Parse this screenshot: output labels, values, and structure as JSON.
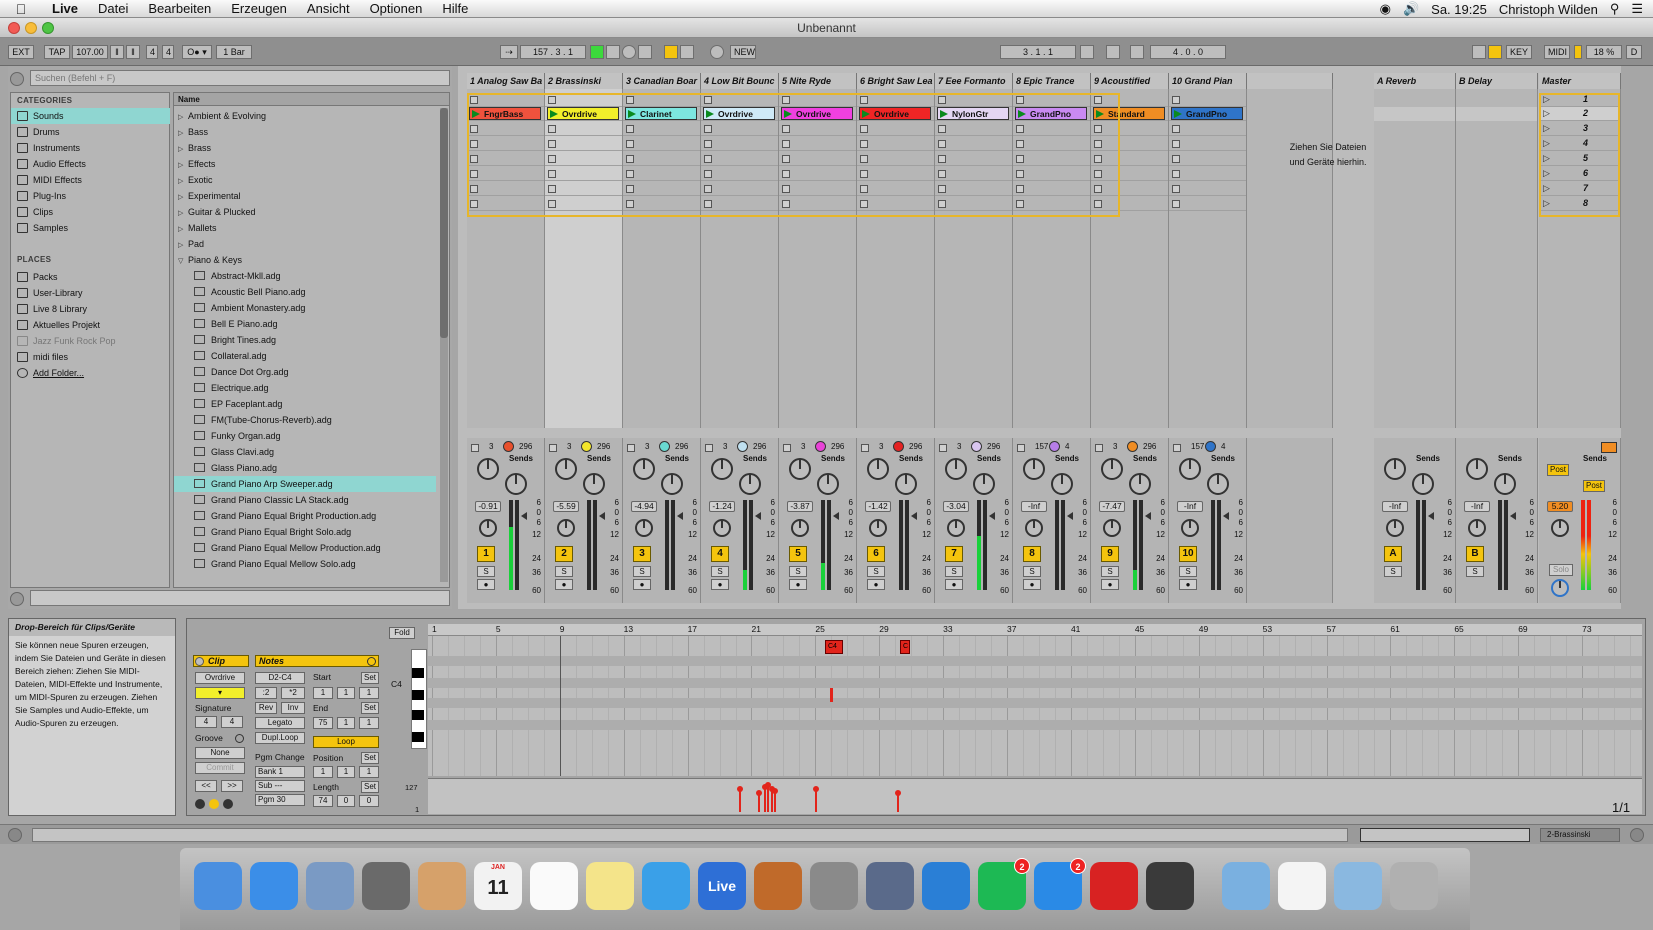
{
  "menubar": {
    "app": "Live",
    "items": [
      "Datei",
      "Bearbeiten",
      "Erzeugen",
      "Ansicht",
      "Optionen",
      "Hilfe"
    ],
    "clock": "Sa. 19:25",
    "user": "Christoph Wilden"
  },
  "window": {
    "title": "Unbenannt"
  },
  "transport": {
    "ext": "EXT",
    "tap": "TAP",
    "tempo": "107.00",
    "signature_num": "4",
    "signature_den": "4",
    "quantize": "1 Bar",
    "arrangement_pos": "157 .  3 .  1",
    "new": "NEW",
    "loop_start": "3 .  1 .  1",
    "loop_length": "4 .  0 .  0",
    "key": "KEY",
    "midi": "MIDI",
    "cpu": "18 %",
    "d": "D"
  },
  "browser": {
    "search_placeholder": "Suchen (Befehl + F)",
    "categories_title": "CATEGORIES",
    "categories": [
      "Sounds",
      "Drums",
      "Instruments",
      "Audio Effects",
      "MIDI Effects",
      "Plug-Ins",
      "Clips",
      "Samples"
    ],
    "places_title": "PLACES",
    "places": [
      "Packs",
      "User-Library",
      "Live 8 Library",
      "Aktuelles Projekt",
      "Jazz Funk Rock Pop",
      "midi files",
      "Add Folder..."
    ],
    "name_header": "Name",
    "folders": [
      "Ambient & Evolving",
      "Bass",
      "Brass",
      "Effects",
      "Exotic",
      "Experimental",
      "Guitar & Plucked",
      "Mallets",
      "Pad",
      "Piano & Keys"
    ],
    "files": [
      "Abstract-Mkll.adg",
      "Acoustic Bell Piano.adg",
      "Ambient Monastery.adg",
      "Bell E Piano.adg",
      "Bright Tines.adg",
      "Collateral.adg",
      "Dance Dot Org.adg",
      "Electrique.adg",
      "EP Faceplant.adg",
      "FM(Tube-Chorus-Reverb).adg",
      "Funky Organ.adg",
      "Glass Clavi.adg",
      "Glass Piano.adg",
      "Grand Piano Arp Sweeper.adg",
      "Grand Piano Classic LA Stack.adg",
      "Grand Piano Equal Bright Production.adg",
      "Grand Piano Equal Bright Solo.adg",
      "Grand Piano Equal Mellow Production.adg",
      "Grand Piano Equal Mellow Solo.adg"
    ]
  },
  "tracks": [
    {
      "name": "1 Analog Saw Ba",
      "clip": "FngrBass",
      "color": "#f0523d",
      "num": "1",
      "vol": "-0.91",
      "in": "3",
      "out": "296",
      "dot": "#e8502c",
      "meter": 0.7
    },
    {
      "name": "2 Brassinski",
      "clip": "Ovrdrive",
      "color": "#f2ef2b",
      "num": "2",
      "vol": "-5.59",
      "in": "3",
      "out": "296",
      "dot": "#f3e52b",
      "meter": 0.0
    },
    {
      "name": "3 Canadian Boar",
      "clip": "Clarinet",
      "color": "#7de6e0",
      "num": "3",
      "vol": "-4.94",
      "in": "3",
      "out": "296",
      "dot": "#69d9d1",
      "meter": 0.0
    },
    {
      "name": "4 Low Bit Bounc",
      "clip": "Ovrdrive",
      "color": "#cfeaf7",
      "num": "4",
      "vol": "-1.24",
      "in": "3",
      "out": "296",
      "dot": "#bfe0f0",
      "meter": 0.22
    },
    {
      "name": "5 Nite Ryde",
      "clip": "Ovrdrive",
      "color": "#f040e0",
      "num": "5",
      "vol": "-3.87",
      "in": "3",
      "out": "296",
      "dot": "#e843d7",
      "meter": 0.3
    },
    {
      "name": "6 Bright Saw Lea",
      "clip": "Ovrdrive",
      "color": "#f02525",
      "num": "6",
      "vol": "-1.42",
      "in": "3",
      "out": "296",
      "dot": "#e42222",
      "meter": 0.0
    },
    {
      "name": "7 Eee Formanto",
      "clip": "NylonGtr",
      "color": "#e4d6f3",
      "num": "7",
      "vol": "-3.04",
      "in": "3",
      "out": "296",
      "dot": "#d9c6f0",
      "meter": 0.6
    },
    {
      "name": "8 Epic Trance",
      "clip": "GrandPno",
      "color": "#c98af2",
      "num": "8",
      "vol": "-Inf",
      "in": "157",
      "out": "4",
      "dot": "#b77ee8",
      "meter": 0.0
    },
    {
      "name": "9 Acoustified",
      "clip": "Standard",
      "color": "#f08d23",
      "num": "9",
      "vol": "-7.47",
      "in": "3",
      "out": "296",
      "dot": "#f08d23",
      "meter": 0.22
    },
    {
      "name": "10 Grand Pian",
      "clip": "GrandPno",
      "color": "#2f74c8",
      "num": "10",
      "vol": "-Inf",
      "in": "157",
      "out": "4",
      "dot": "#2f74c8",
      "meter": 0.0
    }
  ],
  "returns": [
    {
      "name": "A Reverb",
      "letter": "A",
      "vol": "-Inf"
    },
    {
      "name": "B Delay",
      "letter": "B",
      "vol": "-Inf"
    }
  ],
  "master": {
    "name": "Master",
    "vol": "5.20",
    "post1": "Post",
    "post2": "Post",
    "solo": "Solo"
  },
  "scenes": [
    "1",
    "2",
    "3",
    "4",
    "5",
    "6",
    "7",
    "8"
  ],
  "drop_text_1": "Ziehen Sie Dateien",
  "drop_text_2": "und Geräte hierhin.",
  "sends_label": "Sends",
  "scale": [
    "6",
    "0",
    "6",
    "12",
    "24",
    "36",
    "60"
  ],
  "info": {
    "title": "Drop-Bereich für Clips/Geräte",
    "body": "Sie können neue Spuren erzeugen, indem Sie Dateien und Geräte in diesen Bereich ziehen: Ziehen Sie MIDI-Dateien, MIDI-Effekte und Instrumente, um MIDI-Spuren zu erzeugen. Ziehen Sie Samples und Audio-Effekte, um Audio-Spuren zu erzeugen."
  },
  "clipview": {
    "clip_tab": "Clip",
    "notes_tab": "Notes",
    "clip_name": "Ovrdrive",
    "signature": "Signature",
    "sig_num": "4",
    "sig_den": "4",
    "groove": "Groove",
    "groove_val": "None",
    "commit": "Commit",
    "range": "D2-C4",
    "half": ":2",
    "double": "*2",
    "rev": "Rev",
    "inv": "Inv",
    "legato": "Legato",
    "dupl_loop": "Dupl.Loop",
    "start": "Start",
    "end": "End",
    "set": "Set",
    "loop": "Loop",
    "position": "Position",
    "length": "Length",
    "pgm_change": "Pgm Change",
    "bank": "Bank 1",
    "sub": "Sub ---",
    "pgm": "Pgm 30",
    "start_val": [
      "1",
      "1",
      "1"
    ],
    "end_val": [
      "75",
      "1",
      "1"
    ],
    "pos_val": [
      "1",
      "1",
      "1"
    ],
    "len_val": [
      "74",
      "0",
      "0"
    ],
    "fold": "Fold",
    "c4": "C4",
    "vel_max": "127",
    "vel_min": "1",
    "page": "1/1",
    "nav_prev": "<<",
    "nav_next": ">>",
    "sig_label": "Signature"
  },
  "ruler": [
    "1",
    "5",
    "9",
    "13",
    "17",
    "21",
    "25",
    "29",
    "33",
    "37",
    "41",
    "45",
    "49",
    "53",
    "57",
    "61",
    "65",
    "69",
    "73"
  ],
  "notes": [
    {
      "label": "C4",
      "bar": 25.6
    },
    {
      "label": "C",
      "bar": 30.3
    }
  ],
  "statusbar": {
    "track": "2-Brassinski"
  },
  "dock": [
    "Finder",
    "Safari",
    "Mail",
    "Launchpad",
    "Contacts",
    "Calendar",
    "Reminders",
    "Notes",
    "iTunes",
    "Live",
    "GarageBand",
    "System Preferences",
    "Boot Camp",
    "TeamViewer",
    "Spotify",
    "App Store",
    "FileZilla",
    "Ableton",
    "Applications",
    "XLS",
    "Documents",
    "Trash"
  ],
  "dock_badges": {
    "spotify": "2",
    "appstore": "2"
  },
  "calendar_day": "11",
  "calendar_month": "JAN"
}
